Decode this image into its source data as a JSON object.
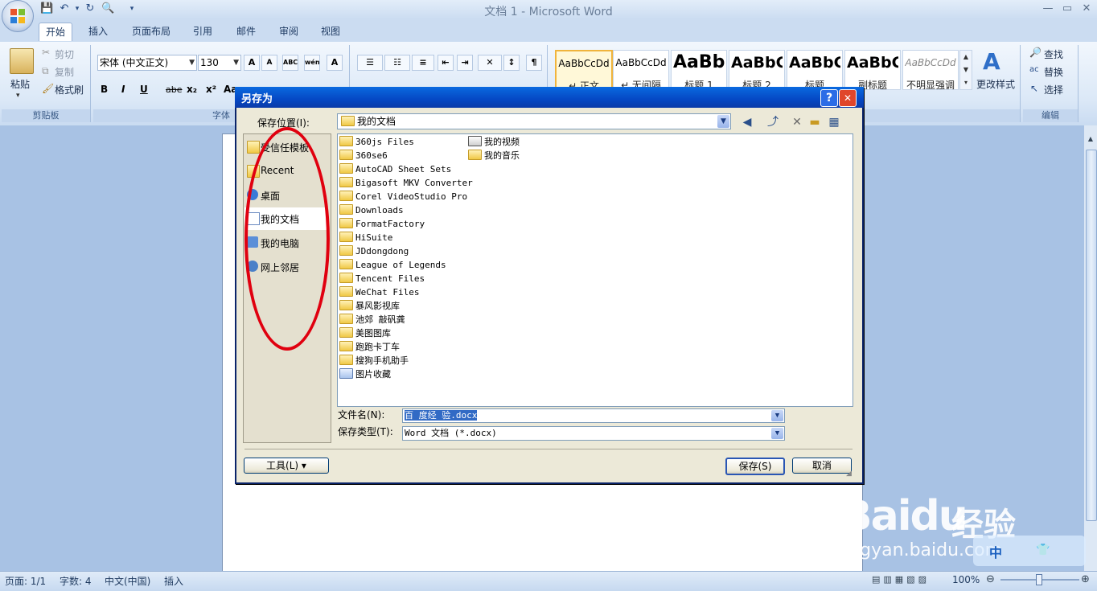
{
  "window": {
    "title": "文档 1 - Microsoft Word"
  },
  "qat": {
    "save_icon": "save-icon",
    "undo_icon": "undo-icon",
    "redo_icon": "redo-icon",
    "preview_icon": "print-preview-icon",
    "customize": "▾"
  },
  "tabs": [
    {
      "label": "开始",
      "active": true
    },
    {
      "label": "插入"
    },
    {
      "label": "页面布局"
    },
    {
      "label": "引用"
    },
    {
      "label": "邮件"
    },
    {
      "label": "审阅"
    },
    {
      "label": "视图"
    }
  ],
  "clipboard": {
    "paste": "粘贴",
    "cut": "剪切",
    "copy": "复制",
    "format_painter": "格式刷",
    "group": "剪贴板"
  },
  "font": {
    "name": "宋体 (中文正文)",
    "size": "130",
    "group": "字体",
    "bold": "B",
    "italic": "I",
    "underline": "U",
    "strike": "abe",
    "sub": "x₂",
    "sup": "x²",
    "grow": "A",
    "shrink": "A",
    "clear": "ABC",
    "phonetic": "wén",
    "border": "A",
    "aa": "Aa"
  },
  "styles": [
    {
      "sample": "AaBbCcDd",
      "name": "↵ 正文"
    },
    {
      "sample": "AaBbCcDd",
      "name": "↵ 无间隔"
    },
    {
      "sample": "AaBb",
      "name": "标题 1"
    },
    {
      "sample": "AaBbC",
      "name": "标题 2"
    },
    {
      "sample": "AaBbC",
      "name": "标题"
    },
    {
      "sample": "AaBbC",
      "name": "副标题"
    },
    {
      "sample": "AaBbCcDd",
      "name": "不明显强调"
    }
  ],
  "change_styles": "更改样式",
  "editing": {
    "find": "查找",
    "replace": "替换",
    "select": "选择",
    "group": "编辑"
  },
  "status": {
    "page": "页面: 1/1",
    "words": "字数: 4",
    "lang": "中文(中国)",
    "mode": "插入",
    "zoom": "100%"
  },
  "dialog": {
    "title": "另存为",
    "help": "?",
    "close": "✕",
    "location_label": "保存位置(I):",
    "location_value": "我的文档",
    "places": [
      {
        "label": "受信任模板",
        "icon": "folder-icon"
      },
      {
        "label": "Recent",
        "icon": "folder-icon"
      },
      {
        "label": "桌面",
        "icon": "desktop-icon"
      },
      {
        "label": "我的文档",
        "icon": "documents-icon",
        "active": true
      },
      {
        "label": "我的电脑",
        "icon": "computer-icon"
      },
      {
        "label": "网上邻居",
        "icon": "network-icon"
      }
    ],
    "files_col1": [
      "360js Files",
      "360se6",
      "AutoCAD Sheet Sets",
      "Bigasoft MKV Converter",
      "Corel VideoStudio Pro",
      "Downloads",
      "FormatFactory",
      "HiSuite",
      "JDdongdong",
      "League of Legends",
      "Tencent Files",
      "WeChat Files",
      "暴风影视库",
      "池郊 敲矾龚",
      "美图图库",
      "跑跑卡丁车",
      "搜狗手机助手",
      "图片收藏"
    ],
    "files_col2": [
      "我的视频",
      "我的音乐"
    ],
    "filename_label": "文件名(N):",
    "filename_value": "百 度经 验.docx",
    "filetype_label": "保存类型(T):",
    "filetype_value": "Word 文档 (*.docx)",
    "tools": "工具(L)",
    "save": "保存(S)",
    "cancel": "取消"
  },
  "watermark": {
    "logo": "Baidu",
    "jingyan": "经验",
    "url": "jingyan.baidu.com",
    "ime": "中"
  },
  "colors": {
    "titlebar": "#0a5fd8",
    "annotation": "#e0000f"
  }
}
